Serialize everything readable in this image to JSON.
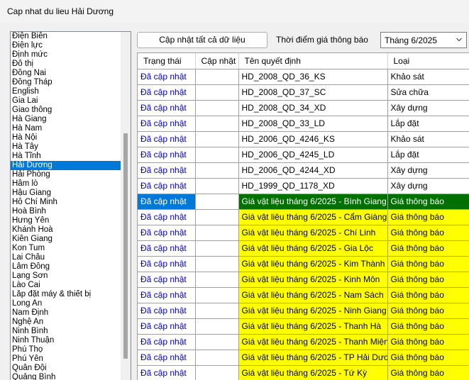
{
  "window": {
    "title": "Cap nhat du lieu Hải Dương"
  },
  "provinces": {
    "items": [
      "Điện Biên",
      "Điện lực",
      "Định mức",
      "Đô thị",
      "Đồng Nai",
      "Đồng Tháp",
      "English",
      "Gia Lai",
      "Giao thông",
      "Hà Giang",
      "Hà Nam",
      "Hà Nội",
      "Hà Tây",
      "Hà Tĩnh",
      "Hải Dương",
      "Hải Phòng",
      "Hầm lò",
      "Hậu Giang",
      "Hồ Chí Minh",
      "Hoà Bình",
      "Hưng Yên",
      "Khánh Hoà",
      "Kiên Giang",
      "Kon Tum",
      "Lai Châu",
      "Lâm Đồng",
      "Lạng Sơn",
      "Lào Cai",
      "Lắp đặt máy & thiết bị",
      "Long An",
      "Nam Định",
      "Nghệ An",
      "Ninh Bình",
      "Ninh Thuận",
      "Phú Thọ",
      "Phú Yên",
      "Quân Đội",
      "Quảng Bình"
    ],
    "selected": "Hải Dương"
  },
  "toolbar": {
    "update_all_label": "Cập nhật tất cả dữ liệu",
    "time_label": "Thời điểm giá thông báo",
    "time_value": "Tháng 6/2025"
  },
  "grid": {
    "columns": [
      "Trạng thái",
      "Cập nhật",
      "Tên quyết định",
      "Loại"
    ],
    "rows": [
      {
        "status": "Đã cập nhật",
        "update": "",
        "name": "HD_2008_QD_36_KS",
        "type": "Khảo sát",
        "highlight": "none"
      },
      {
        "status": "Đã cập nhật",
        "update": "",
        "name": "HD_2008_QD_37_SC",
        "type": "Sửa chữa",
        "highlight": "none"
      },
      {
        "status": "Đã cập nhật",
        "update": "",
        "name": "HD_2008_QD_34_XD",
        "type": "Xây dựng",
        "highlight": "none"
      },
      {
        "status": "Đã cập nhật",
        "update": "",
        "name": "HD_2008_QD_33_LD",
        "type": "Lắp đặt",
        "highlight": "none"
      },
      {
        "status": "Đã cập nhật",
        "update": "",
        "name": "HD_2006_QD_4246_KS",
        "type": "Khảo sát",
        "highlight": "none"
      },
      {
        "status": "Đã cập nhật",
        "update": "",
        "name": "HD_2006_QD_4245_LD",
        "type": "Lắp đặt",
        "highlight": "none"
      },
      {
        "status": "Đã cập nhật",
        "update": "",
        "name": "HD_2006_QD_4244_XD",
        "type": "Xây dựng",
        "highlight": "none"
      },
      {
        "status": "Đã cập nhật",
        "update": "",
        "name": "HD_1999_QD_1178_XD",
        "type": "Xây dựng",
        "highlight": "none"
      },
      {
        "status": "Đã cập nhật",
        "update": "",
        "name": "Giá vật liệu tháng 6/2025 - Bình Giang",
        "type": "Giá thông báo",
        "highlight": "green"
      },
      {
        "status": "Đã cập nhật",
        "update": "",
        "name": "Giá vật liệu tháng 6/2025 - Cẩm Giàng",
        "type": "Giá thông báo",
        "highlight": "yellow"
      },
      {
        "status": "Đã cập nhật",
        "update": "",
        "name": "Giá vật liệu tháng 6/2025 - Chí Linh",
        "type": "Giá thông báo",
        "highlight": "yellow"
      },
      {
        "status": "Đã cập nhật",
        "update": "",
        "name": "Giá vật liệu tháng 6/2025 - Gia Lộc",
        "type": "Giá thông báo",
        "highlight": "yellow"
      },
      {
        "status": "Đã cập nhật",
        "update": "",
        "name": "Giá vật liệu tháng 6/2025 - Kim Thành",
        "type": "Giá thông báo",
        "highlight": "yellow"
      },
      {
        "status": "Đã cập nhật",
        "update": "",
        "name": "Giá vật liệu tháng 6/2025 - Kinh Môn",
        "type": "Giá thông báo",
        "highlight": "yellow"
      },
      {
        "status": "Đã cập nhật",
        "update": "",
        "name": "Giá vật liệu tháng 6/2025 - Nam Sách",
        "type": "Giá thông báo",
        "highlight": "yellow"
      },
      {
        "status": "Đã cập nhật",
        "update": "",
        "name": "Giá vật liệu tháng 6/2025 - Ninh Giang",
        "type": "Giá thông báo",
        "highlight": "yellow"
      },
      {
        "status": "Đã cập nhật",
        "update": "",
        "name": "Giá vật liệu tháng 6/2025 - Thanh Hà",
        "type": "Giá thông báo",
        "highlight": "yellow"
      },
      {
        "status": "Đã cập nhật",
        "update": "",
        "name": "Giá vật liệu tháng 6/2025 - Thanh Miện",
        "type": "Giá thông báo",
        "highlight": "yellow"
      },
      {
        "status": "Đã cập nhật",
        "update": "",
        "name": "Giá vật liệu tháng 6/2025 - TP Hải Dương",
        "type": "Giá thông báo",
        "highlight": "yellow"
      },
      {
        "status": "Đã cập nhật",
        "update": "",
        "name": "Giá vật liệu tháng 6/2025 - Tứ Kỳ",
        "type": "Giá thông báo",
        "highlight": "yellow"
      }
    ]
  },
  "colors": {
    "selection": "#0078d7",
    "highlight_yellow": "#ffff00",
    "highlight_green": "#007000",
    "status_text": "#0000cc"
  },
  "icons": {
    "combo_arrow": "chevron-down-icon"
  }
}
